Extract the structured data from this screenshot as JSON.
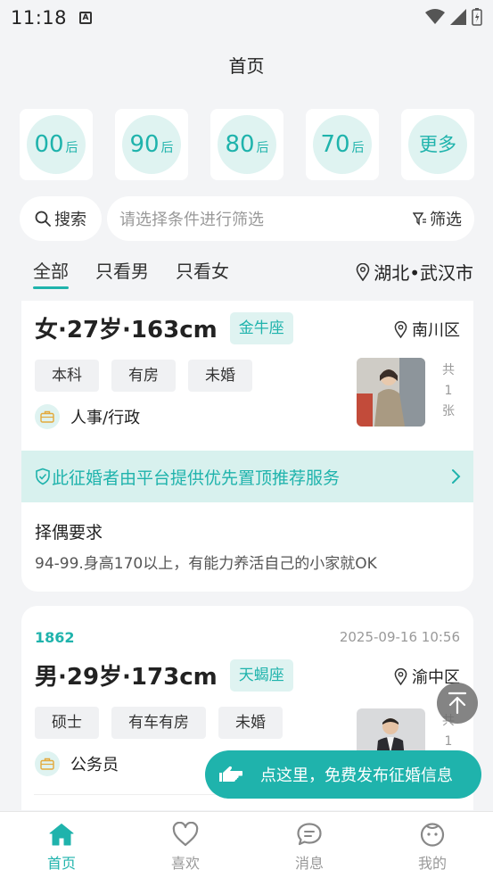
{
  "status": {
    "time": "11:18",
    "notif_icon": "A"
  },
  "header": {
    "title": "首页"
  },
  "generations": [
    {
      "num": "00",
      "suffix": "后"
    },
    {
      "num": "90",
      "suffix": "后"
    },
    {
      "num": "80",
      "suffix": "后"
    },
    {
      "num": "70",
      "suffix": "后"
    }
  ],
  "more_label": "更多",
  "search": {
    "label": "搜索",
    "placeholder": "请选择条件进行筛选",
    "filter_label": "筛选"
  },
  "tabs": [
    {
      "label": "全部"
    },
    {
      "label": "只看男"
    },
    {
      "label": "只看女"
    }
  ],
  "location": "湖北•武汉市",
  "cards": [
    {
      "title": "女·27岁·163cm",
      "zodiac": "金牛座",
      "district": "南川区",
      "tags": [
        "本科",
        "有房",
        "未婚"
      ],
      "job": "人事/行政",
      "photo_count": [
        "共",
        "1",
        "张"
      ],
      "promo": "此征婚者由平台提供优先置顶推荐服务",
      "req_title": "择偶要求",
      "req_text": "94-99.身高170以上，有能力养活自己的小家就OK"
    },
    {
      "id": "1862",
      "date": "2025-09-16 10:56",
      "title": "男·29岁·173cm",
      "zodiac": "天蝎座",
      "district": "渝中区",
      "tags": [
        "硕士",
        "有车有房",
        "未婚"
      ],
      "job": "公务员",
      "photo_count": [
        "共",
        "1"
      ]
    }
  ],
  "publish_label": "点这里，免费发布征婚信息",
  "nav": [
    {
      "label": "首页",
      "icon": "home-icon"
    },
    {
      "label": "喜欢",
      "icon": "heart-icon"
    },
    {
      "label": "消息",
      "icon": "message-icon"
    },
    {
      "label": "我的",
      "icon": "profile-icon"
    }
  ],
  "colors": {
    "accent": "#1fb3ac",
    "accent_light": "#dff3f1",
    "background": "#f3f4f6"
  }
}
